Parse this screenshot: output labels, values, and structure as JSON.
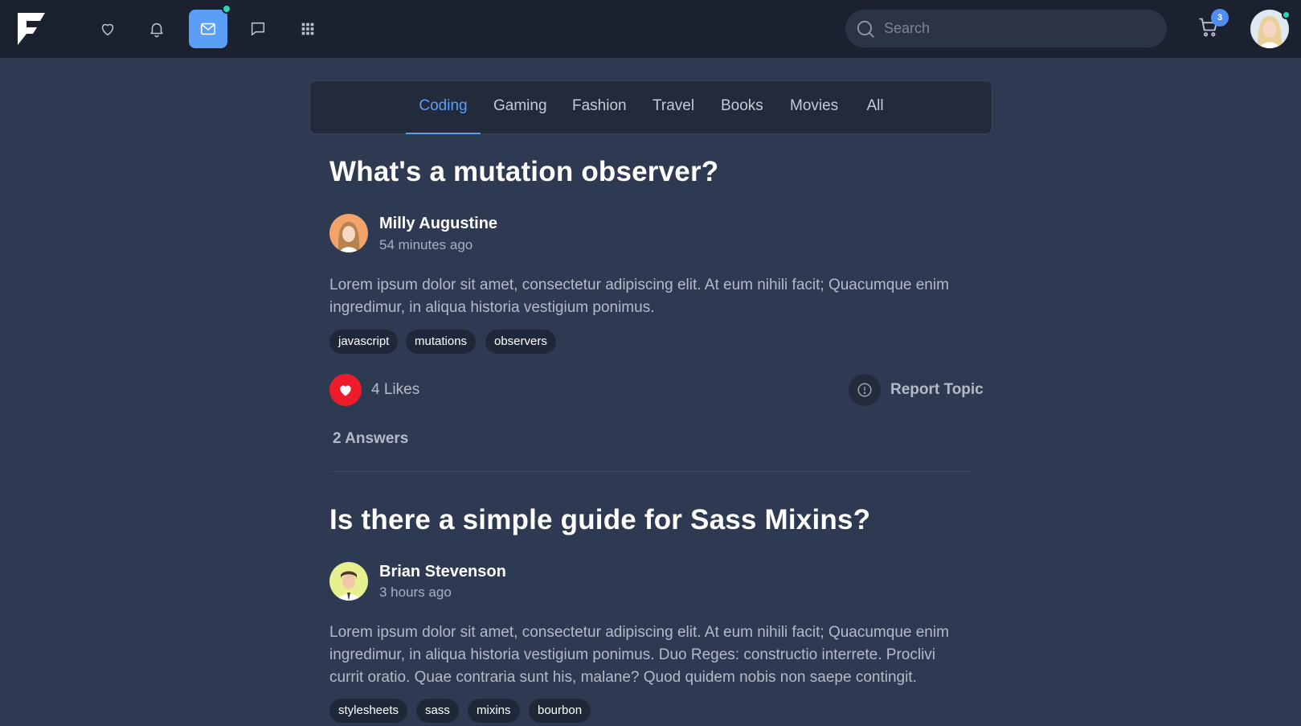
{
  "navbar": {
    "search_placeholder": "Search",
    "cart_count": "3",
    "icons": [
      "heart-icon",
      "bell-icon",
      "mail-icon",
      "chat-icon",
      "grid-icon"
    ],
    "accent": "#5b9ef5",
    "notification_dot_color": "#2ad6b4"
  },
  "tabs": [
    {
      "label": "Coding",
      "active": true
    },
    {
      "label": "Gaming",
      "active": false
    },
    {
      "label": "Fashion",
      "active": false
    },
    {
      "label": "Travel",
      "active": false
    },
    {
      "label": "Books",
      "active": false
    },
    {
      "label": "Movies",
      "active": false
    },
    {
      "label": "All",
      "active": false
    }
  ],
  "posts": [
    {
      "title": "What's a mutation observer?",
      "author": "Milly Augustine",
      "time": "54 minutes ago",
      "body": "Lorem ipsum dolor sit amet, consectetur adipiscing elit. At eum nihili facit; Quacumque enim ingredimur, in aliqua historia vestigium ponimus.",
      "tags": [
        "javascript",
        "mutations",
        "observers"
      ],
      "likes": "4 Likes",
      "report_label": "Report Topic",
      "answers": "2 Answers"
    },
    {
      "title": "Is there a simple guide for Sass Mixins?",
      "author": "Brian Stevenson",
      "time": "3 hours ago",
      "body": "Lorem ipsum dolor sit amet, consectetur adipiscing elit. At eum nihili facit; Quacumque enim ingredimur, in aliqua historia vestigium ponimus. Duo Reges: constructio interrete. Proclivi currit oratio. Quae contraria sunt his, malane? Quod quidem nobis non saepe contingit.",
      "tags": [
        "stylesheets",
        "sass",
        "mixins",
        "bourbon"
      ]
    }
  ]
}
